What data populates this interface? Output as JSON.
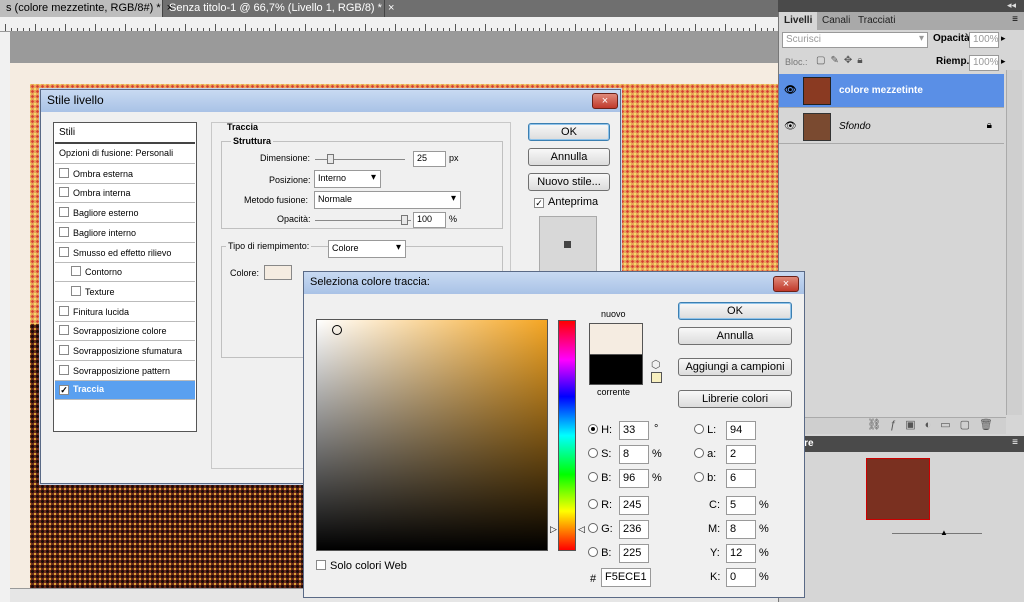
{
  "tabs": [
    {
      "label": "s (colore mezzetinte, RGB/8#) *",
      "close": "×",
      "active": true
    },
    {
      "label": "Senza titolo-1 @ 66,7% (Livello 1, RGB/8) *",
      "close": "×",
      "active": false
    }
  ],
  "ruler_labels": [
    "",
    "",
    "",
    "",
    "",
    "",
    "",
    "",
    "",
    "",
    "",
    ""
  ],
  "right_panel": {
    "tabs": [
      "Livelli",
      "Canali",
      "Tracciati"
    ],
    "blend_mode": "Scurisci",
    "opacity_label": "Opacità:",
    "opacity_value": "100%",
    "lock_label": "Bloc.:",
    "fill_label": "Riemp.:",
    "fill_value": "100%",
    "layers": [
      {
        "name": "colore mezzetinte",
        "selected": true
      },
      {
        "name": "Sfondo",
        "selected": false
      }
    ],
    "navigator_title": "gatore"
  },
  "stile_livello": {
    "title": "Stile livello",
    "close": "×",
    "list_header": "Stili",
    "items": [
      {
        "label": "Opzioni di fusione: Personali",
        "check": false,
        "indent": false,
        "hascheck": false
      },
      {
        "label": "Ombra esterna",
        "check": false,
        "indent": false,
        "hascheck": true
      },
      {
        "label": "Ombra interna",
        "check": false,
        "indent": false,
        "hascheck": true
      },
      {
        "label": "Bagliore esterno",
        "check": false,
        "indent": false,
        "hascheck": true
      },
      {
        "label": "Bagliore interno",
        "check": false,
        "indent": false,
        "hascheck": true
      },
      {
        "label": "Smusso ed effetto rilievo",
        "check": false,
        "indent": false,
        "hascheck": true
      },
      {
        "label": "Contorno",
        "check": false,
        "indent": true,
        "hascheck": true
      },
      {
        "label": "Texture",
        "check": false,
        "indent": true,
        "hascheck": true
      },
      {
        "label": "Finitura lucida",
        "check": false,
        "indent": false,
        "hascheck": true
      },
      {
        "label": "Sovrapposizione colore",
        "check": false,
        "indent": false,
        "hascheck": true
      },
      {
        "label": "Sovrapposizione sfumatura",
        "check": false,
        "indent": false,
        "hascheck": true
      },
      {
        "label": "Sovrapposizione pattern",
        "check": false,
        "indent": false,
        "hascheck": true
      },
      {
        "label": "Traccia",
        "check": true,
        "indent": false,
        "hascheck": true,
        "selected": true
      }
    ],
    "section_title": "Traccia",
    "subsection": "Struttura",
    "dimensione_label": "Dimensione:",
    "dimensione_value": "25",
    "dimensione_unit": "px",
    "posizione_label": "Posizione:",
    "posizione_value": "Interno",
    "metodo_label": "Metodo fusione:",
    "metodo_value": "Normale",
    "opacita_label": "Opacità:",
    "opacita_value": "100",
    "opacita_unit": "%",
    "tipo_label": "Tipo di riempimento:",
    "tipo_value": "Colore",
    "colore_label": "Colore:",
    "ok": "OK",
    "annulla": "Annulla",
    "nuovo_stile": "Nuovo stile...",
    "anteprima": "Anteprima"
  },
  "color_picker": {
    "title": "Seleziona colore traccia:",
    "close": "×",
    "ok": "OK",
    "annulla": "Annulla",
    "aggiungi": "Aggiungi a campioni",
    "librerie": "Librerie colori",
    "nuovo": "nuovo",
    "corrente": "corrente",
    "new_color": "#f5ece1",
    "current_color": "#000000",
    "hsb": {
      "h_label": "H:",
      "h": "33",
      "h_unit": "°",
      "s_label": "S:",
      "s": "8",
      "s_unit": "%",
      "b_label": "B:",
      "b": "96",
      "b_unit": "%"
    },
    "rgb": {
      "r_label": "R:",
      "r": "245",
      "g_label": "G:",
      "g": "236",
      "b_label": "B:",
      "b": "225"
    },
    "lab": {
      "l_label": "L:",
      "l": "94",
      "a_label": "a:",
      "a": "2",
      "b_label": "b:",
      "b": "6"
    },
    "cmyk": {
      "c_label": "C:",
      "c": "5",
      "m_label": "M:",
      "m": "8",
      "y_label": "Y:",
      "y": "12",
      "k_label": "K:",
      "k": "0",
      "unit": "%"
    },
    "hex_label": "#",
    "hex": "F5ECE1",
    "web_only": "Solo colori Web",
    "hue_color": "#f5a623"
  }
}
